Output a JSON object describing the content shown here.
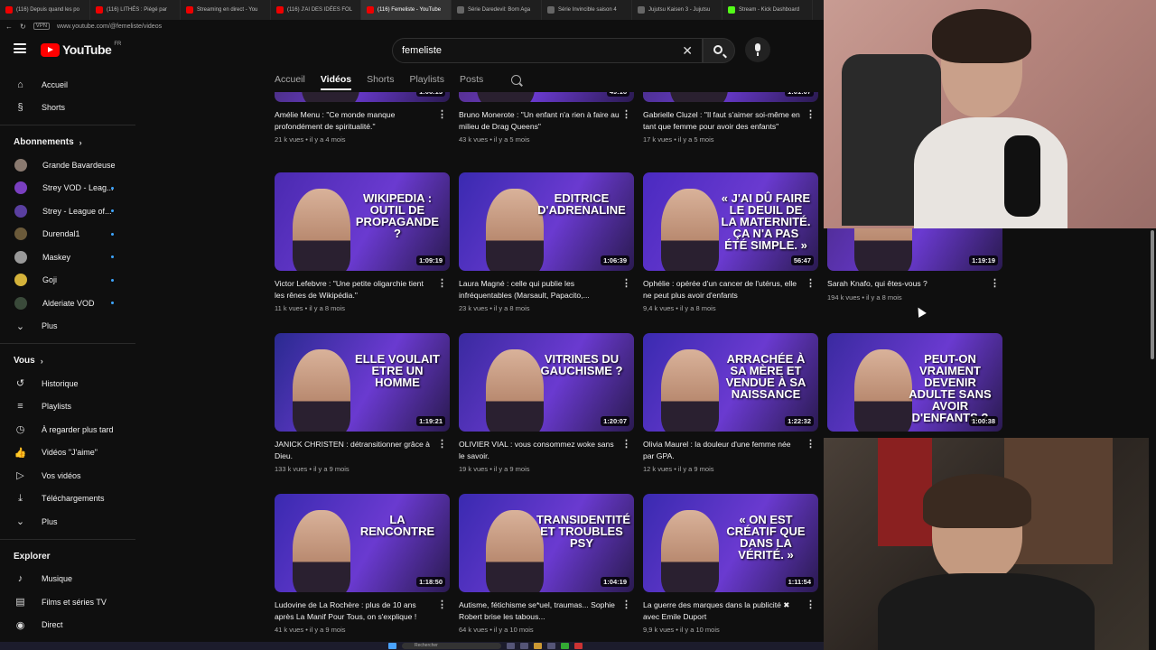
{
  "browser": {
    "tabs": [
      {
        "title": "(116) Depuis quand les po",
        "active": false
      },
      {
        "title": "(116) LITHÉS : Piégé par",
        "active": false
      },
      {
        "title": "Streaming en direct - You",
        "active": false
      },
      {
        "title": "(116) J'AI DES IDÉES FOL",
        "active": false
      },
      {
        "title": "(116) Femeliste - YouTube",
        "active": true
      },
      {
        "title": "Série Daredevil: Born Aga",
        "active": false
      },
      {
        "title": "Série Invincible saison 4",
        "active": false
      },
      {
        "title": "Jujutsu Kaisen 3 - Jujutsu",
        "active": false
      },
      {
        "title": "Stream - Kick Dashboard",
        "active": false
      }
    ],
    "url": "www.youtube.com/@femeliste/videos",
    "vpn_badge": "VPN"
  },
  "header": {
    "logo_text": "YouTube",
    "logo_region": "FR",
    "search_value": "femeliste"
  },
  "sidebar": {
    "main": [
      {
        "label": "Accueil",
        "icon": "home-icon",
        "glyph": "⌂"
      },
      {
        "label": "Shorts",
        "icon": "shorts-icon",
        "glyph": "§"
      }
    ],
    "subs_heading": "Abonnements",
    "subs": [
      {
        "label": "Grande Bavardeuse",
        "color": "#8a7a70",
        "live": false
      },
      {
        "label": "Strey VOD - Leag...",
        "color": "#7a3fc0",
        "live": true
      },
      {
        "label": "Strey - League of...",
        "color": "#5a3fa0",
        "live": true
      },
      {
        "label": "Durendal1",
        "color": "#6b5a3a",
        "live": true
      },
      {
        "label": "Maskey",
        "color": "#999999",
        "live": true
      },
      {
        "label": "Goji",
        "color": "#d4b23a",
        "live": true
      },
      {
        "label": "Alderiate VOD",
        "color": "#3a4a3a",
        "live": true
      }
    ],
    "subs_more": "Plus",
    "you_heading": "Vous",
    "you": [
      {
        "label": "Historique",
        "icon": "history-icon",
        "glyph": "↺"
      },
      {
        "label": "Playlists",
        "icon": "playlists-icon",
        "glyph": "≡"
      },
      {
        "label": "À regarder plus tard",
        "icon": "watch-later-icon",
        "glyph": "◷"
      },
      {
        "label": "Vidéos \"J'aime\"",
        "icon": "like-icon",
        "glyph": "👍"
      },
      {
        "label": "Vos vidéos",
        "icon": "your-videos-icon",
        "glyph": "▷"
      },
      {
        "label": "Téléchargements",
        "icon": "download-icon",
        "glyph": "⤓"
      },
      {
        "label": "Plus",
        "icon": "chevron-down-icon",
        "glyph": "⌄"
      }
    ],
    "explore_heading": "Explorer",
    "explore": [
      {
        "label": "Musique",
        "icon": "music-icon",
        "glyph": "♪"
      },
      {
        "label": "Films et séries TV",
        "icon": "movies-icon",
        "glyph": "▤"
      },
      {
        "label": "Direct",
        "icon": "live-icon",
        "glyph": "◉"
      }
    ]
  },
  "channel_tabs": {
    "items": [
      "Accueil",
      "Vidéos",
      "Shorts",
      "Playlists",
      "Posts"
    ],
    "active": "Vidéos"
  },
  "videos": [
    {
      "title": "Amélie Menu : \"Ce monde manque profondément de spiritualité.\"",
      "views": "21 k vues",
      "age": "il y a 4 mois",
      "duration": "1:06:13",
      "thumb_text": "",
      "bg": "#3a2a5a"
    },
    {
      "title": "Bruno Monerote : \"Un enfant n'a rien à faire au milieu de Drag Queens\"",
      "views": "43 k vues",
      "age": "il y a 5 mois",
      "duration": "49:16",
      "thumb_text": "",
      "bg": "#4a2a6a"
    },
    {
      "title": "Gabrielle Cluzel : \"Il faut s'aimer soi-même en tant que femme pour avoir des enfants\"",
      "views": "17 k vues",
      "age": "il y a 5 mois",
      "duration": "1:01:07",
      "thumb_text": "",
      "bg": "#3a2a6a"
    },
    {
      "title": "Victor Lefebvre : \"Une petite oligarchie tient les rênes de Wikipédia.\"",
      "views": "11 k vues",
      "age": "il y a 8 mois",
      "duration": "1:09:19",
      "thumb_text": "WIKIPEDIA : OUTIL DE PROPAGANDE ?",
      "bg": "#4a2ab0"
    },
    {
      "title": "Laura Magné : celle qui publie les infréquentables (Marsault, Papacito,...",
      "views": "23 k vues",
      "age": "il y a 8 mois",
      "duration": "1:06:39",
      "thumb_text": "EDITRICE D'ADRENALINE",
      "bg": "#3a2ab0"
    },
    {
      "title": "Ophélie : opérée d'un cancer de l'utérus, elle ne peut plus avoir d'enfants",
      "views": "9,4 k vues",
      "age": "il y a 8 mois",
      "duration": "56:47",
      "thumb_text": "« J'AI DÛ FAIRE LE DEUIL DE LA MATERNITÉ. ÇA N'A PAS ÉTÉ SIMPLE. »",
      "bg": "#4a2ac0"
    },
    {
      "title": "Sarah Knafo, qui êtes-vous ?",
      "views": "194 k vues",
      "age": "il y a 8 mois",
      "duration": "1:19:19",
      "thumb_text": "",
      "bg": "#4a2a8a"
    },
    {
      "title": "JANICK CHRISTEN : détransitionner grâce à Dieu.",
      "views": "133 k vues",
      "age": "il y a 9 mois",
      "duration": "1:19:21",
      "thumb_text": "ELLE VOULAIT ETRE UN HOMME",
      "bg": "#2a2a90"
    },
    {
      "title": "OLIVIER VIAL : vous consommez woke sans le savoir.",
      "views": "19 k vues",
      "age": "il y a 9 mois",
      "duration": "1:20:07",
      "thumb_text": "VITRINES DU GAUCHISME ?",
      "bg": "#3a2aa0"
    },
    {
      "title": "Olivia Maurel : la douleur d'une femme née par GPA.",
      "views": "12 k vues",
      "age": "il y a 9 mois",
      "duration": "1:22:32",
      "thumb_text": "ARRACHÉE À SA MÈRE ET VENDUE À SA NAISSANCE",
      "bg": "#3a2ab0"
    },
    {
      "title": "",
      "views": "",
      "age": "",
      "duration": "1:00:38",
      "thumb_text": "PEUT-ON VRAIMENT DEVENIR ADULTE SANS AVOIR D'ENFANTS ?",
      "bg": "#3a2aa0"
    },
    {
      "title": "Ludovine de La Rochère : plus de 10 ans après La Manif Pour Tous, on s'explique !",
      "views": "41 k vues",
      "age": "il y a 9 mois",
      "duration": "1:18:50",
      "thumb_text": "LA RENCONTRE",
      "bg": "#3a2ab0"
    },
    {
      "title": "Autisme, fétichisme se*uel, traumas... Sophie Robert brise les tabous...",
      "views": "64 k vues",
      "age": "il y a 10 mois",
      "duration": "1:04:19",
      "thumb_text": "TRANSIDENTITÉ ET TROUBLES PSY",
      "bg": "#3a2ab0"
    },
    {
      "title": "La guerre des marques dans la publicité ✖ avec Emile Duport",
      "views": "9,9 k vues",
      "age": "il y a 10 mois",
      "duration": "1:11:54",
      "thumb_text": "« ON EST CRÉATIF QUE DANS LA VÉRITÉ. »",
      "bg": "#3a2ab0"
    }
  ],
  "taskbar": {
    "search_placeholder": "Rechercher"
  }
}
